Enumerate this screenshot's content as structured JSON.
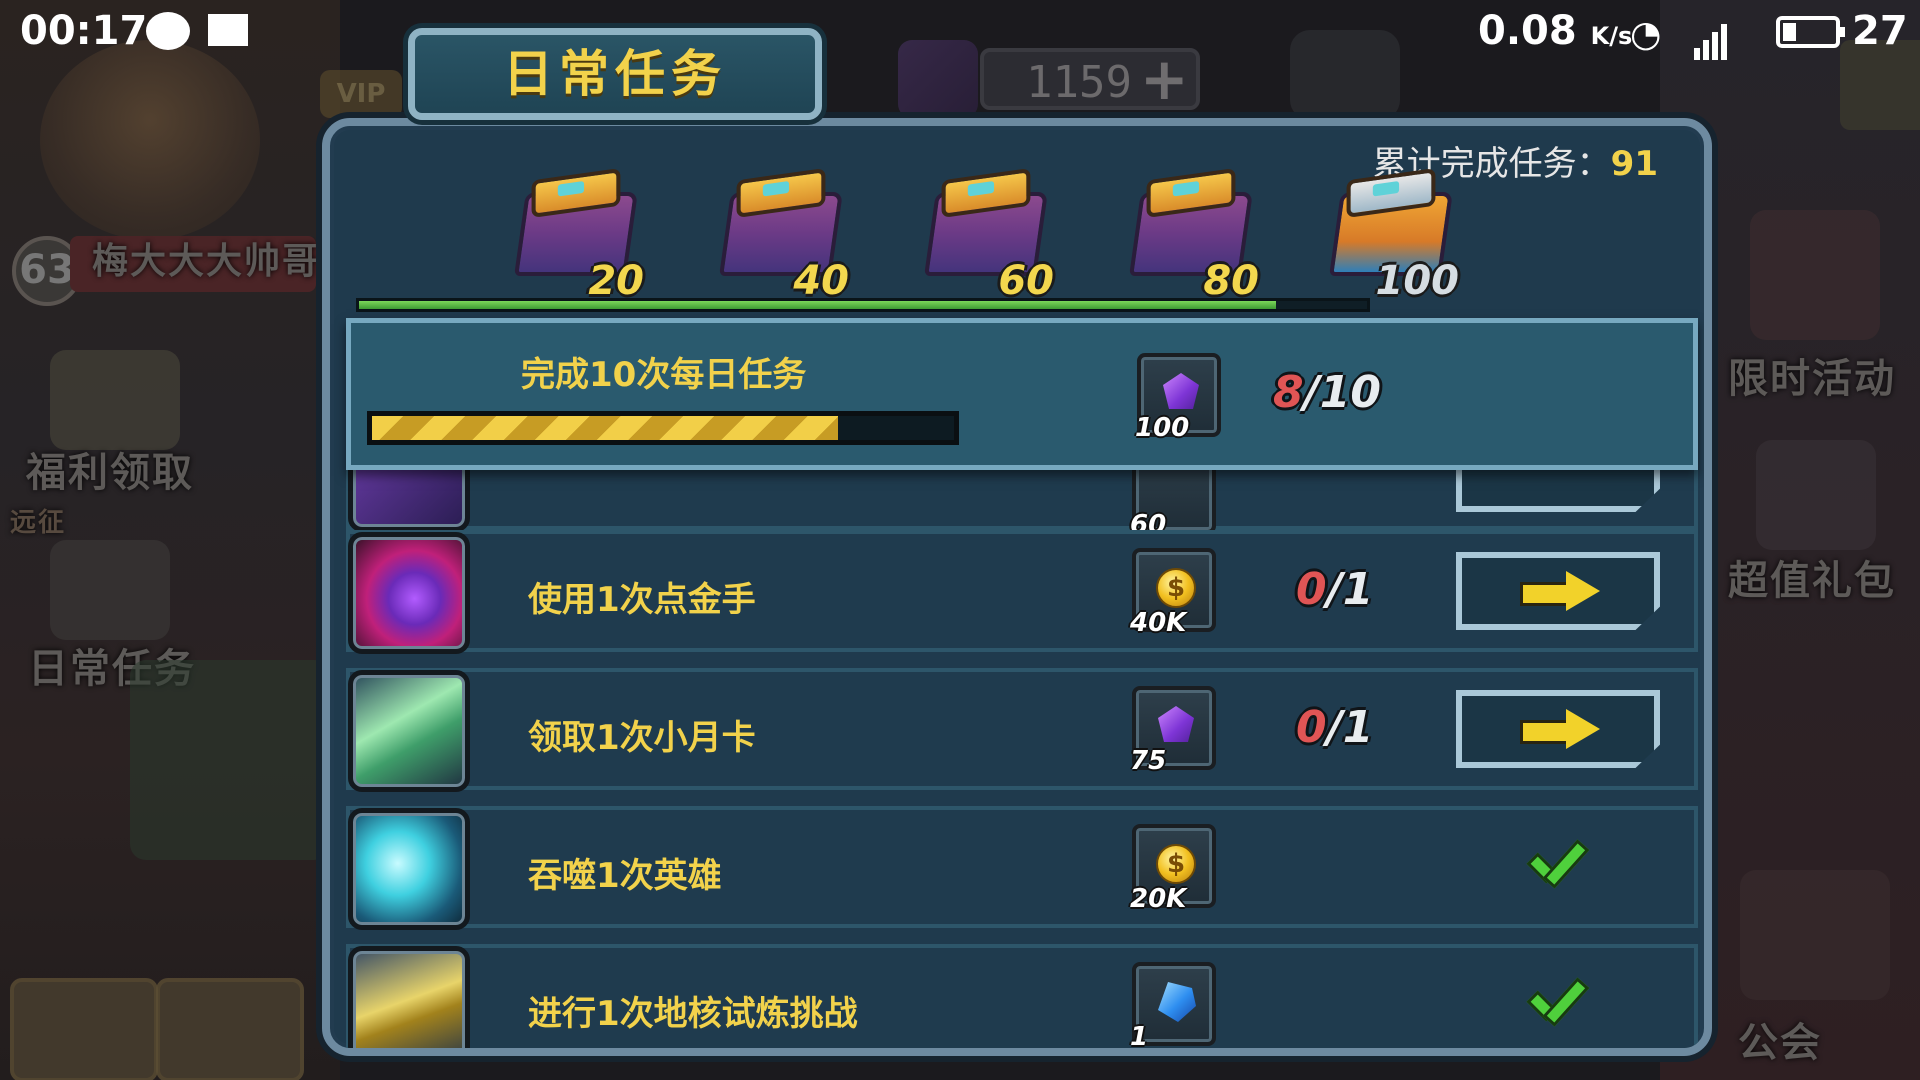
{
  "status_bar": {
    "time": "00:17",
    "speed_value": "0.08",
    "speed_unit": "K/s",
    "battery": "27",
    "icons": [
      "chat-icon",
      "image-icon",
      "wifi-icon",
      "signal-4g-icon",
      "battery-icon"
    ]
  },
  "background": {
    "player_level": "63",
    "player_name": "梅大大大帅哥",
    "vip_label": "VIP",
    "currency_amount": "1159",
    "left_menu": [
      "福利领取",
      "远征",
      "日常任务"
    ],
    "right_menu": [
      "限时活动",
      "超值礼包",
      "公会"
    ]
  },
  "panel": {
    "title": "日常任务",
    "total_label": "累计完成任务：",
    "total_count": "91",
    "chests": [
      {
        "threshold": "20",
        "type": "purple"
      },
      {
        "threshold": "40",
        "type": "purple"
      },
      {
        "threshold": "60",
        "type": "purple"
      },
      {
        "threshold": "80",
        "type": "purple"
      },
      {
        "threshold": "100",
        "type": "gold"
      }
    ],
    "overall_progress": 0.91,
    "highlighted_task": {
      "title": "完成10次每日任务",
      "reward_icon": "purple-gem-icon",
      "reward_amount": "100",
      "current": "8",
      "separator": "/",
      "total": "10",
      "progress": 0.8
    },
    "partial_row": {
      "reward_amount": "60"
    },
    "tasks": [
      {
        "title": "使用1次点金手",
        "thumb_icon": "midas-gem-icon",
        "reward_icon": "gold-coin-icon",
        "reward_amount": "40K",
        "current": "0",
        "separator": "/",
        "total": "1",
        "state": "go"
      },
      {
        "title": "领取1次小月卡",
        "thumb_icon": "monthly-card-icon",
        "reward_icon": "purple-gem-icon",
        "reward_amount": "75",
        "current": "0",
        "separator": "/",
        "total": "1",
        "state": "go"
      },
      {
        "title": "吞噬1次英雄",
        "thumb_icon": "devour-capsule-icon",
        "reward_icon": "gold-coin-icon",
        "reward_amount": "20K",
        "state": "done"
      },
      {
        "title": "进行1次地核试炼挑战",
        "thumb_icon": "drill-icon",
        "reward_icon": "blue-crystal-icon",
        "reward_amount": "1",
        "state": "done"
      }
    ],
    "coin_symbol": "$"
  },
  "colors": {
    "accent_gold": "#f2d24b",
    "count_current": "#e05555",
    "done_green": "#4fd03c",
    "panel_bg": "#1f3a4d",
    "panel_border": "#6d8aa0"
  }
}
